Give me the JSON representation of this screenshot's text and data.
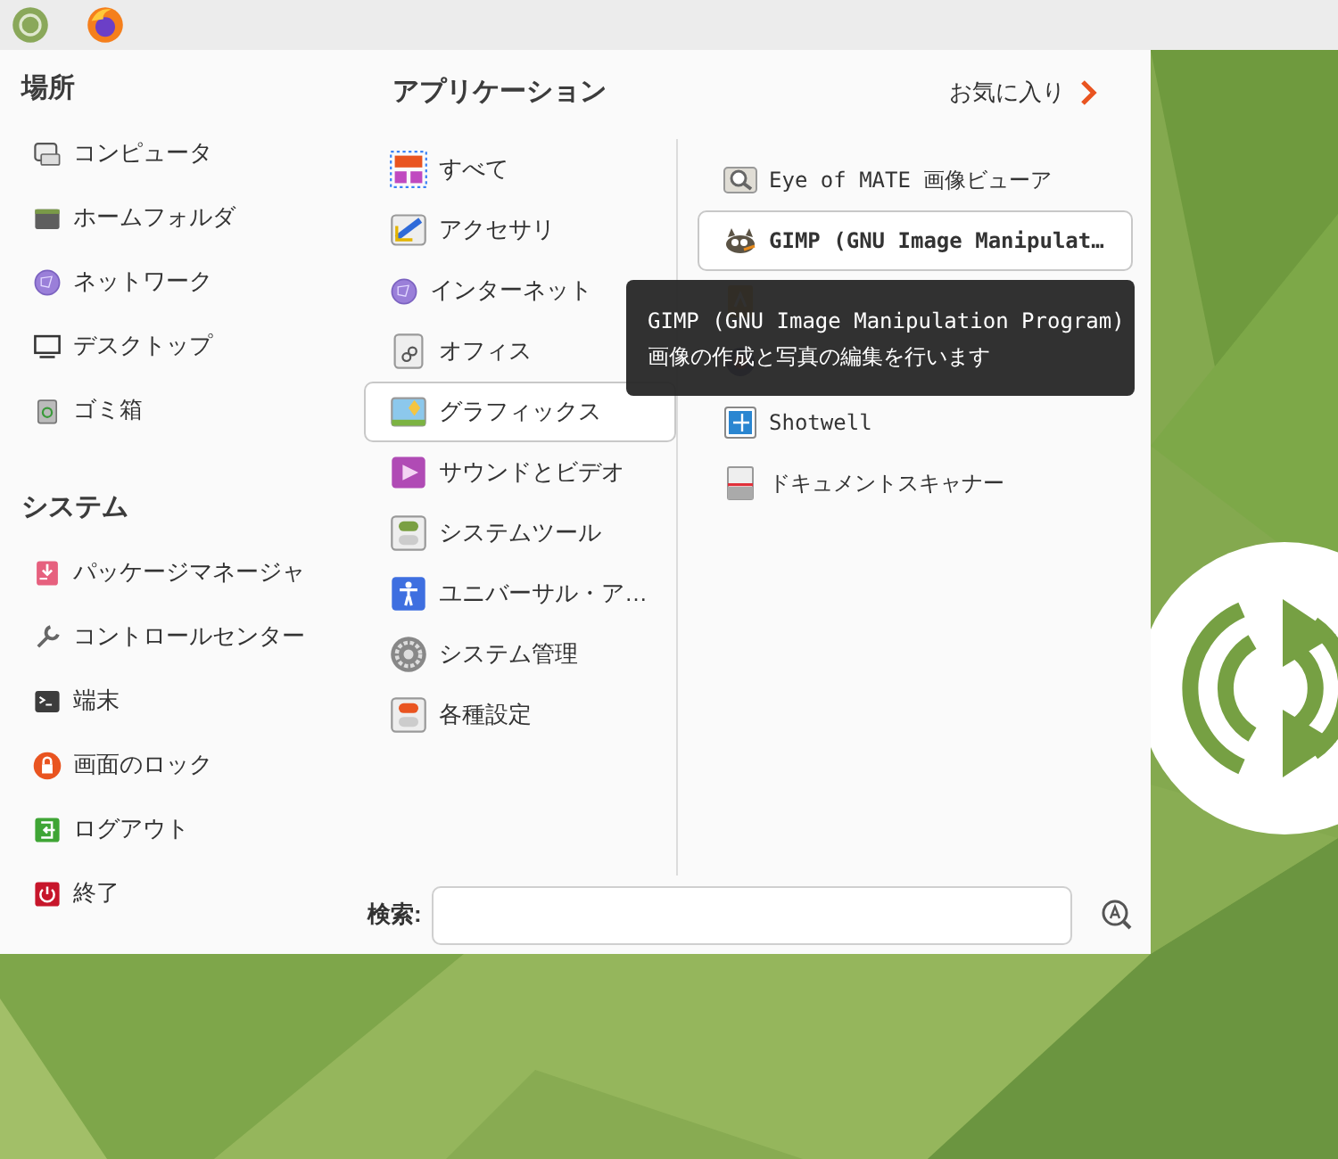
{
  "top_panel": {
    "launchers": [
      {
        "kind": "menu"
      },
      {
        "kind": "browser"
      }
    ]
  },
  "places": {
    "title": "場所",
    "items": [
      {
        "label": "コンピュータ",
        "kind": "computer"
      },
      {
        "label": "ホームフォルダ",
        "kind": "folder"
      },
      {
        "label": "ネットワーク",
        "kind": "network"
      },
      {
        "label": "デスクトップ",
        "kind": "desktop"
      },
      {
        "label": "ゴミ箱",
        "kind": "trash"
      }
    ]
  },
  "system": {
    "title": "システム",
    "items": [
      {
        "label": "パッケージマネージャ",
        "kind": "package"
      },
      {
        "label": "コントロールセンター",
        "kind": "wrench"
      },
      {
        "label": "端末",
        "kind": "terminal"
      },
      {
        "label": "画面のロック",
        "kind": "lock"
      },
      {
        "label": "ログアウト",
        "kind": "logout"
      },
      {
        "label": "終了",
        "kind": "power"
      }
    ]
  },
  "categories": {
    "title": "アプリケーション",
    "items": [
      {
        "label": "すべて",
        "kind": "all",
        "selected": false
      },
      {
        "label": "アクセサリ",
        "kind": "accessories",
        "selected": false
      },
      {
        "label": "インターネット",
        "kind": "network",
        "selected": false
      },
      {
        "label": "オフィス",
        "kind": "office",
        "selected": false
      },
      {
        "label": "グラフィックス",
        "kind": "graphics",
        "selected": true
      },
      {
        "label": "サウンドとビデオ",
        "kind": "media",
        "selected": false
      },
      {
        "label": "システムツール",
        "kind": "toggle-green",
        "selected": false
      },
      {
        "label": "ユニバーサル・ア…",
        "kind": "accessibility",
        "selected": false
      },
      {
        "label": "システム管理",
        "kind": "gear",
        "selected": false
      },
      {
        "label": "各種設定",
        "kind": "toggle-red",
        "selected": false
      }
    ]
  },
  "favorites_link": {
    "label": "お気に入り"
  },
  "apps": [
    {
      "label": "Eye of MATE 画像ビューア",
      "kind": "magnifier",
      "selected": false
    },
    {
      "label": "GIMP (GNU Image Manipulat…",
      "kind": "gimp",
      "selected": true
    },
    {
      "kind": "draw"
    },
    {
      "kind": "color"
    },
    {
      "label": "Shotwell",
      "kind": "shotwell",
      "selected": false
    },
    {
      "label": "ドキュメントスキャナー",
      "kind": "scanner",
      "selected": false
    }
  ],
  "tooltip": {
    "title": "GIMP (GNU Image Manipulation Program)",
    "description": "画像の作成と写真の編集を行います"
  },
  "search": {
    "label": "検索:"
  }
}
